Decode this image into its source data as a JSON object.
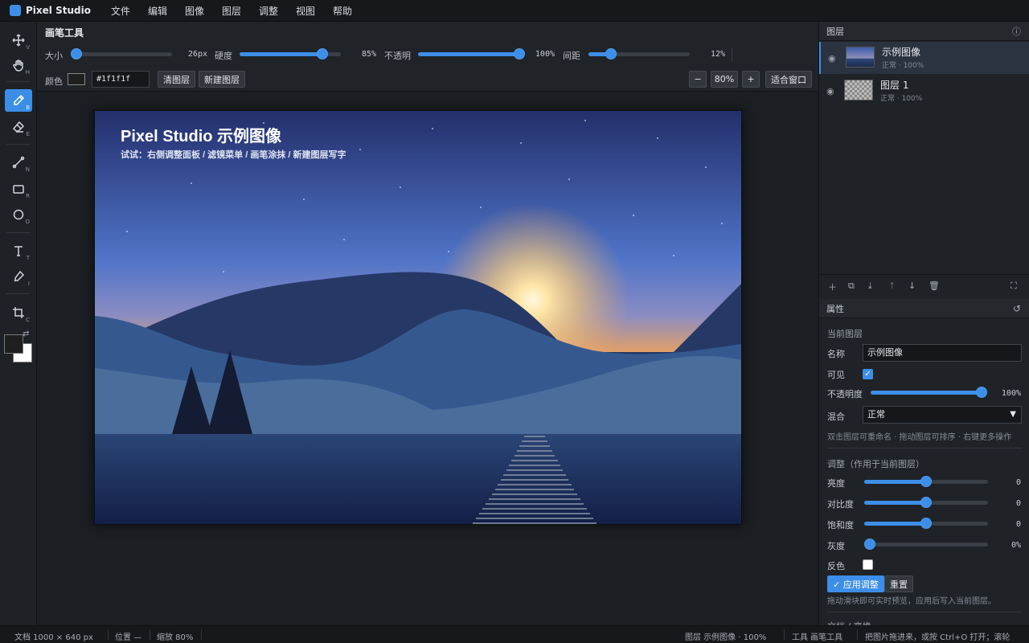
{
  "app": {
    "name": "Pixel Studio"
  },
  "menu": [
    "文件",
    "编辑",
    "图像",
    "图层",
    "调整",
    "视图",
    "帮助"
  ],
  "tools": [
    {
      "name": "move-tool",
      "key": "V"
    },
    {
      "name": "hand-tool",
      "key": "H"
    },
    {
      "name": "brush-tool",
      "key": "B",
      "active": true
    },
    {
      "name": "eraser-tool",
      "key": "E"
    },
    {
      "name": "line-tool",
      "key": "N"
    },
    {
      "name": "rectangle-tool",
      "key": "R"
    },
    {
      "name": "ellipse-tool",
      "key": "O"
    },
    {
      "name": "text-tool",
      "key": "T"
    },
    {
      "name": "eyedropper-tool",
      "key": "I"
    },
    {
      "name": "crop-tool",
      "key": "C"
    }
  ],
  "swatches": {
    "foreground": "#1f1f1f",
    "background": "#ffffff",
    "swap_icon": "⇄"
  },
  "options": {
    "title": "画笔工具",
    "size": {
      "label": "大小",
      "value": "26px",
      "fraction": 0.04
    },
    "hardness": {
      "label": "硬度",
      "value": "85%",
      "fraction": 0.82
    },
    "opacity": {
      "label": "不透明",
      "value": "100%",
      "fraction": 1.0
    },
    "spacing": {
      "label": "间距",
      "value": "12%",
      "fraction": 0.22
    },
    "color_label": "颜色",
    "color_hex": "#1f1f1f",
    "color_hex_text": "#1f1f1f",
    "clear_layer": "清图层",
    "new_layer": "新建图层",
    "zoom_out": "−",
    "zoom_value": "80%",
    "zoom_in": "+",
    "fit_window": "适合窗口"
  },
  "canvas": {
    "title": "Pixel Studio 示例图像",
    "subtitle": "试试：右侧调整面板 / 滤镜菜单 / 画笔涂抹 / 新建图层写字"
  },
  "layers_panel": {
    "title": "图层",
    "info_icon": "ⓘ",
    "layers": [
      {
        "name": "示例图像",
        "sub": "正常 · 100%",
        "active": true
      },
      {
        "name": "图层 1",
        "sub": "正常 · 100%",
        "active": false
      }
    ],
    "eye_icon": "👁"
  },
  "properties": {
    "title": "属性",
    "section_current": "当前图层",
    "name_label": "名称",
    "name_value": "示例图像",
    "visible_label": "可见",
    "visible": true,
    "opacity_label": "不透明度",
    "opacity_value": "100%",
    "opacity_fraction": 1.0,
    "blend_label": "混合",
    "blend_value": "正常",
    "hint1": "双击图层可重命名 · 拖动图层可排序 · 右键更多操作",
    "section_adjust": "调整（作用于当前图层）",
    "brightness": {
      "label": "亮度",
      "value": "0",
      "fraction": 0.5
    },
    "contrast": {
      "label": "对比度",
      "value": "0",
      "fraction": 0.5
    },
    "saturation": {
      "label": "饱和度",
      "value": "0",
      "fraction": 0.5
    },
    "grayscale": {
      "label": "灰度",
      "value": "0%",
      "fraction": 0.0
    },
    "invert_label": "反色",
    "invert": false,
    "apply_button": "✓ 应用调整",
    "reset_button": "重置",
    "hint2": "拖动滑块即可实时预览，应用后写入当前图层。",
    "section_next": "文档 / 变换"
  },
  "status": {
    "doc": "文档 1000 × 640 px",
    "position": "位置 —",
    "zoom": "缩放 80%",
    "layer": "图层 示例图像 · 100%",
    "tool": "工具 画笔工具",
    "tip": "把图片拖进来，或按 Ctrl+O 打开；滚轮"
  }
}
